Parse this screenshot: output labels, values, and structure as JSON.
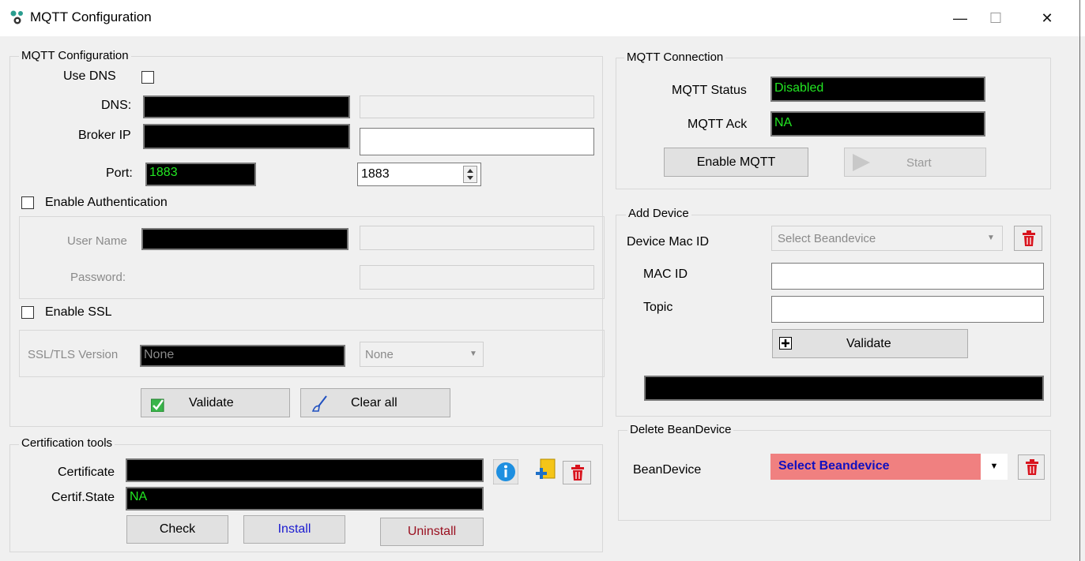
{
  "window": {
    "title": "MQTT Configuration",
    "minimize": "—",
    "maximize": "☐",
    "close": "✕"
  },
  "config": {
    "group_title": "MQTT Configuration",
    "use_dns_label": "Use DNS",
    "use_dns_checked": false,
    "dns_label": "DNS:",
    "broker_ip_label": "Broker IP",
    "port_label": "Port:",
    "port_display": "1883",
    "port_value": "1883",
    "enable_auth_label": "Enable Authentication",
    "user_name_label": "User Name",
    "password_label": "Password:",
    "enable_ssl_label": "Enable SSL",
    "ssl_version_label": "SSL/TLS Version",
    "ssl_display": "None",
    "ssl_select": "None",
    "validate_label": "Validate",
    "clear_all_label": "Clear all"
  },
  "cert": {
    "group_title": "Certification tools",
    "certificate_label": "Certificate",
    "state_label": "Certif.State",
    "state_value": "NA",
    "check_label": "Check",
    "install_label": "Install",
    "uninstall_label": "Uninstall"
  },
  "connection": {
    "group_title": "MQTT Connection",
    "status_label": "MQTT Status",
    "status_value": "Disabled",
    "ack_label": "MQTT Ack",
    "ack_value": "NA",
    "enable_label": "Enable MQTT",
    "start_label": "Start"
  },
  "add_device": {
    "group_title": "Add Device",
    "mac_id_select_label": "Device Mac ID",
    "select_placeholder": "Select Beandevice",
    "mac_id_label": "MAC ID",
    "topic_label": "Topic",
    "validate_label": "Validate"
  },
  "delete_device": {
    "group_title": "Delete BeanDevice",
    "device_label": "BeanDevice",
    "select_value": "Select Beandevice"
  },
  "colors": {
    "status_text": "#22e622",
    "delete_select_bg": "#f08080",
    "delete_select_text": "#1010c0",
    "install_text": "#1a1ad0",
    "uninstall_text": "#9a1020"
  }
}
